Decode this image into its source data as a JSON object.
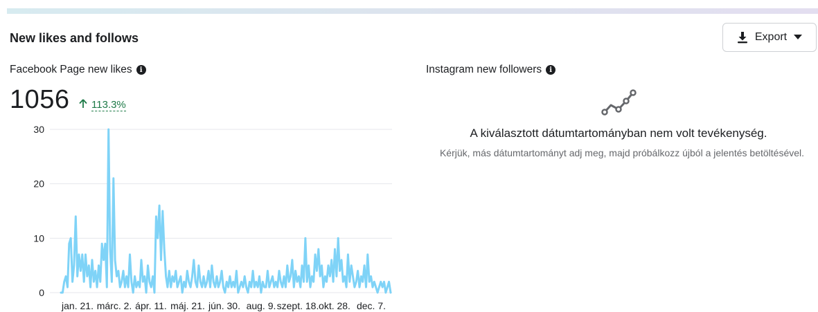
{
  "section": {
    "title": "New likes and follows"
  },
  "export_button": {
    "label": "Export"
  },
  "facebook": {
    "label": "Facebook Page new likes",
    "total": "1056",
    "delta": "113.3%"
  },
  "instagram": {
    "label": "Instagram new followers",
    "empty_title": "A kiválasztott dátumtartományban nem volt tevékenység.",
    "empty_desc": "Kérjük, más dátumtartományt adj meg, majd próbálkozz újból a jelentés betöltésével."
  },
  "colors": {
    "line": "#7fd3f7",
    "grid": "#e4e6eb",
    "positive": "#1d7a47"
  },
  "chart_data": {
    "type": "line",
    "title": "",
    "xlabel": "",
    "ylabel": "",
    "ylim": [
      0,
      30
    ],
    "yticks": [
      0,
      10,
      20,
      30
    ],
    "grid": true,
    "x_tick_labels": [
      "jan. 21.",
      "márc. 2.",
      "ápr. 11.",
      "máj. 21.",
      "jún. 30.",
      "aug. 9.",
      "szept. 18.",
      "okt. 28.",
      "dec. 7."
    ],
    "series": [
      {
        "values": [
          0,
          0,
          2,
          3,
          1,
          9,
          10,
          2,
          5,
          14,
          3,
          7,
          4,
          7,
          2,
          7,
          3,
          5,
          1,
          6,
          2,
          4,
          1,
          5,
          2,
          9,
          6,
          9,
          1,
          30,
          8,
          2,
          21,
          6,
          3,
          4,
          1,
          2,
          4,
          1,
          3,
          1,
          7,
          2,
          0,
          3,
          1,
          2,
          1,
          6,
          2,
          3,
          0,
          5,
          2,
          1,
          3,
          0,
          14,
          10,
          16,
          6,
          15,
          8,
          3,
          1,
          4,
          1,
          3,
          2,
          4,
          1,
          2,
          3,
          0,
          2,
          1,
          4,
          2,
          1,
          3,
          6,
          2,
          1,
          5,
          2,
          1,
          3,
          1,
          2,
          4,
          1,
          5,
          2,
          1,
          3,
          1,
          2,
          4,
          1,
          0,
          2,
          1,
          3,
          1,
          2,
          1,
          4,
          0,
          1,
          2,
          1,
          3,
          1,
          0,
          2,
          1,
          4,
          1,
          2,
          1,
          3,
          0,
          2,
          1,
          1,
          4,
          1,
          2,
          3,
          1,
          2,
          1,
          4,
          2,
          1,
          3,
          1,
          5,
          2,
          3,
          6,
          1,
          4,
          2,
          3,
          1,
          5,
          2,
          10,
          2,
          5,
          1,
          3,
          2,
          7,
          4,
          8,
          3,
          5,
          1,
          3,
          2,
          5,
          3,
          6,
          2,
          8,
          3,
          10,
          4,
          6,
          2,
          3,
          1,
          7,
          2,
          5,
          3,
          1,
          2,
          4,
          1,
          3,
          2,
          5,
          1,
          7,
          2,
          3,
          1,
          2,
          1,
          0,
          1,
          2,
          1,
          2,
          0,
          1,
          2,
          0
        ]
      }
    ]
  }
}
